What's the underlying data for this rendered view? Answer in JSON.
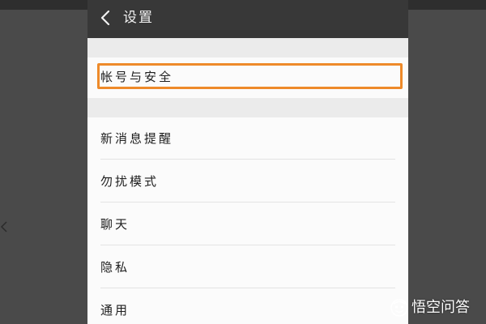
{
  "header": {
    "title": "设置",
    "back_icon": "chevron-left-icon"
  },
  "settings": {
    "account_security": "帐号与安全",
    "items": [
      {
        "label": "新消息提醒"
      },
      {
        "label": "勿扰模式"
      },
      {
        "label": "聊天"
      },
      {
        "label": "隐私"
      },
      {
        "label": "通用"
      }
    ]
  },
  "highlight_color": "#ee8a2a",
  "watermark": {
    "text": "悟空问答",
    "logo": "wukong-logo"
  }
}
